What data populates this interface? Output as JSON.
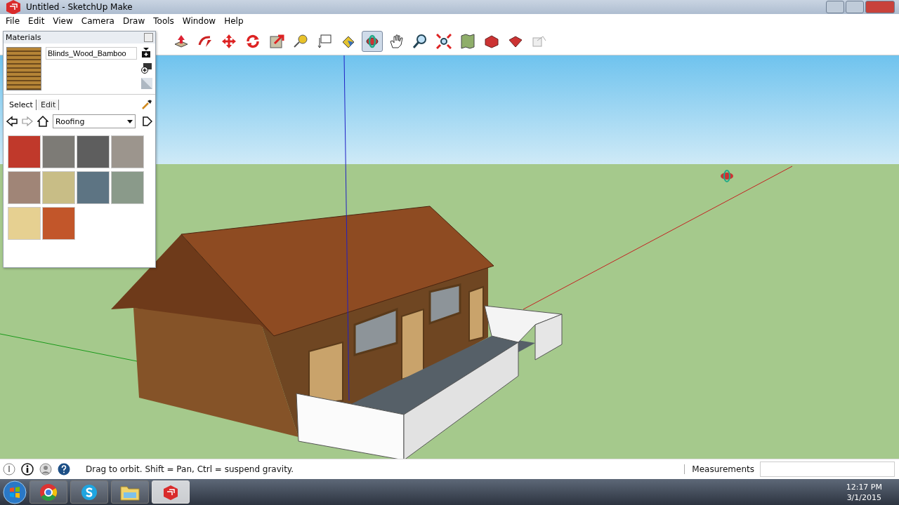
{
  "window": {
    "title": "Untitled - SketchUp Make"
  },
  "menu": [
    "File",
    "Edit",
    "View",
    "Camera",
    "Draw",
    "Tools",
    "Window",
    "Help"
  ],
  "toolbar": {
    "tools": [
      {
        "kind": "pushpull",
        "selected": false
      },
      {
        "kind": "followme",
        "selected": false
      },
      {
        "kind": "move",
        "selected": false
      },
      {
        "kind": "rotate",
        "selected": false
      },
      {
        "kind": "scale",
        "selected": false
      },
      {
        "kind": "tape",
        "selected": false
      },
      {
        "kind": "text",
        "selected": false
      },
      {
        "kind": "paint",
        "selected": false
      },
      {
        "kind": "orbit",
        "selected": true
      },
      {
        "kind": "pan",
        "selected": false
      },
      {
        "kind": "zoom",
        "selected": false
      },
      {
        "kind": "extents",
        "selected": false
      },
      {
        "kind": "map",
        "selected": false
      },
      {
        "kind": "warehouse",
        "selected": false
      },
      {
        "kind": "extension",
        "selected": false
      },
      {
        "kind": "share",
        "selected": false
      }
    ]
  },
  "materials": {
    "title": "Materials",
    "current": "Blinds_Wood_Bamboo",
    "tabs": [
      {
        "label": "Select",
        "selected": true
      },
      {
        "label": "Edit",
        "selected": false
      }
    ],
    "collection": "Roofing",
    "swatches": [
      {
        "color": "#c0392b"
      },
      {
        "color": "#7d7b76"
      },
      {
        "color": "#5e5e5e"
      },
      {
        "color": "#9c958d"
      },
      {
        "color": "#a08577"
      },
      {
        "color": "#c8bd86"
      },
      {
        "color": "#5d7483"
      },
      {
        "color": "#8a9a8a"
      },
      {
        "color": "#e6d091"
      },
      {
        "color": "#c2562a"
      }
    ]
  },
  "status_bar": {
    "hint": "Drag to orbit. Shift = Pan, Ctrl = suspend gravity.",
    "measurements_label": "Measurements"
  },
  "taskbar": {
    "apps": [
      {
        "kind": "chrome",
        "selected": false
      },
      {
        "kind": "skype",
        "selected": false
      },
      {
        "kind": "folder",
        "selected": false
      },
      {
        "kind": "sketchup",
        "selected": true
      }
    ],
    "time": "12:17 PM",
    "date": "3/1/2015"
  }
}
